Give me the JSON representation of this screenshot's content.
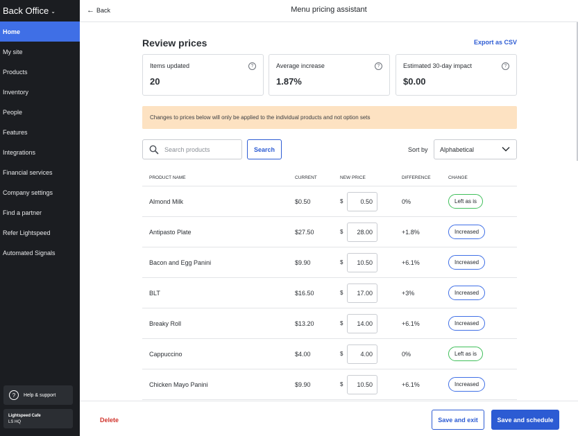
{
  "sidebar": {
    "brand": "Back Office",
    "items": [
      {
        "label": "Home",
        "active": true
      },
      {
        "label": "My site"
      },
      {
        "label": "Products"
      },
      {
        "label": "Inventory"
      },
      {
        "label": "People"
      },
      {
        "label": "Features"
      },
      {
        "label": "Integrations"
      },
      {
        "label": "Financial services"
      },
      {
        "label": "Company settings"
      },
      {
        "label": "Find a partner"
      },
      {
        "label": "Refer Lightspeed"
      },
      {
        "label": "Automated Signals"
      }
    ],
    "help_label": "Help & support",
    "store_name": "Lightspeed Cafe",
    "store_location": "LS HQ"
  },
  "topbar": {
    "back_label": "Back",
    "title": "Menu pricing assistant"
  },
  "review": {
    "title": "Review prices",
    "export_label": "Export as CSV"
  },
  "stats": [
    {
      "label": "Items updated",
      "value": "20"
    },
    {
      "label": "Average increase",
      "value": "1.87%"
    },
    {
      "label": "Estimated 30-day impact",
      "value": "$0.00"
    }
  ],
  "notice": "Changes to prices below will only be applied to the individual products and not option sets",
  "search": {
    "placeholder": "Search products",
    "button_label": "Search"
  },
  "sort": {
    "label": "Sort by",
    "selected": "Alphabetical"
  },
  "table": {
    "headers": {
      "name": "Product name",
      "current": "Current",
      "new_price": "New price",
      "difference": "Difference",
      "change": "Change"
    },
    "currency_symbol": "$",
    "rows": [
      {
        "name": "Almond Milk",
        "current": "$0.50",
        "new_price": "0.50",
        "difference": "0%",
        "change": "Left as is"
      },
      {
        "name": "Antipasto Plate",
        "current": "$27.50",
        "new_price": "28.00",
        "difference": "+1.8%",
        "change": "Increased"
      },
      {
        "name": "Bacon and Egg Panini",
        "current": "$9.90",
        "new_price": "10.50",
        "difference": "+6.1%",
        "change": "Increased"
      },
      {
        "name": "BLT",
        "current": "$16.50",
        "new_price": "17.00",
        "difference": "+3%",
        "change": "Increased"
      },
      {
        "name": "Breaky Roll",
        "current": "$13.20",
        "new_price": "14.00",
        "difference": "+6.1%",
        "change": "Increased"
      },
      {
        "name": "Cappuccino",
        "current": "$4.00",
        "new_price": "4.00",
        "difference": "0%",
        "change": "Left as is"
      },
      {
        "name": "Chicken Mayo Panini",
        "current": "$9.90",
        "new_price": "10.50",
        "difference": "+6.1%",
        "change": "Increased"
      }
    ]
  },
  "footer": {
    "delete_label": "Delete",
    "save_exit_label": "Save and exit",
    "save_schedule_label": "Save and schedule"
  },
  "colors": {
    "accent": "#2c5bd3",
    "sidebar_bg": "#1b1d21",
    "active_nav": "#3f6fe6",
    "notice_bg": "#fde2c2",
    "badge_increased": "#3f6fe6",
    "badge_left": "#3fbf5a",
    "delete": "#d0342c"
  }
}
